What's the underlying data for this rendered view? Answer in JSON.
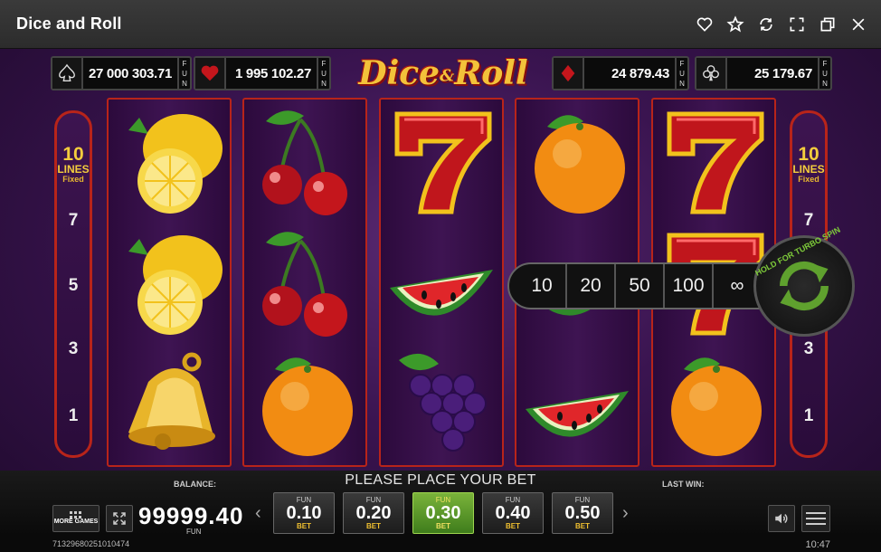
{
  "window": {
    "title": "Dice and Roll"
  },
  "window_icons": [
    "heart-icon",
    "star-icon",
    "refresh-icon",
    "fullscreen-icon",
    "restore-window-icon",
    "close-icon"
  ],
  "jackpots": [
    {
      "suit": "spade",
      "amount": "27 000 303.71",
      "fun": "F U N"
    },
    {
      "suit": "heart",
      "amount": "1 995 102.27",
      "fun": "F U N"
    },
    {
      "suit": "diamond",
      "amount": "24 879.43",
      "fun": "F U N"
    },
    {
      "suit": "club",
      "amount": "25 179.67",
      "fun": "F U N"
    }
  ],
  "logo": {
    "word1": "Dice",
    "amp": "&",
    "word2": "Roll"
  },
  "lines_panel": {
    "count": "10",
    "label": "LINES",
    "fixed": "Fixed",
    "numbers_left": [
      "7",
      "5",
      "3",
      "1"
    ],
    "numbers_right": [
      "7",
      "5",
      "3",
      "1"
    ]
  },
  "reels": [
    [
      "lemon",
      "lemon",
      "bell"
    ],
    [
      "cherry",
      "cherry",
      "orange"
    ],
    [
      "seven",
      "watermelon",
      "grapes"
    ],
    [
      "orange",
      "watermelon",
      "watermelon"
    ],
    [
      "seven",
      "seven",
      "orange"
    ]
  ],
  "autoplay_options": [
    "10",
    "20",
    "50",
    "100",
    "∞"
  ],
  "turbo": {
    "text": "HOLD FOR TURBO SPIN"
  },
  "footer": {
    "prompt": "PLEASE PLACE YOUR BET",
    "balance_label": "BALANCE:",
    "last_win_label": "LAST WIN:",
    "balance": "99999.40",
    "balance_currency": "FUN",
    "more_games": "MORE GAMES",
    "bets": [
      {
        "fun": "FUN",
        "value": "0.10",
        "bet": "BET"
      },
      {
        "fun": "FUN",
        "value": "0.20",
        "bet": "BET"
      },
      {
        "fun": "FUN",
        "value": "0.30",
        "bet": "BET"
      },
      {
        "fun": "FUN",
        "value": "0.40",
        "bet": "BET"
      },
      {
        "fun": "FUN",
        "value": "0.50",
        "bet": "BET"
      }
    ],
    "selected_bet_index": 2,
    "prev_arrow": "‹",
    "next_arrow": "›"
  },
  "status": {
    "session_id": "71329680251010474",
    "time": "10:47"
  },
  "colors": {
    "frame_red": "#b8241a",
    "gold": "#f4cd3d",
    "selected_bet": "#5fa12e",
    "turbo_green": "#7ecb3a"
  }
}
